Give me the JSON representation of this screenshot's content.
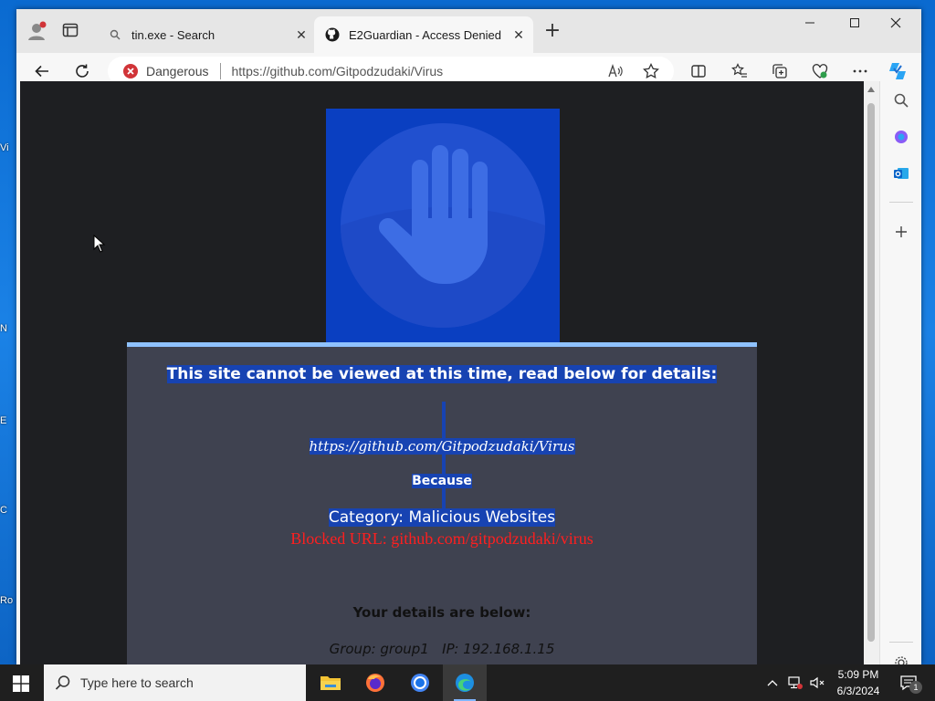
{
  "desktop": {
    "edge_icon_labels": [
      "Vi",
      "N",
      "E",
      "C",
      "Ro"
    ]
  },
  "browser": {
    "tabs": [
      {
        "title": "tin.exe - Search",
        "icon": "search-icon",
        "active": false
      },
      {
        "title": "E2Guardian - Access Denied",
        "icon": "github-icon",
        "active": true
      }
    ],
    "address": {
      "security_label": "Dangerous",
      "url": "https://github.com/Gitpodzudaki/Virus"
    }
  },
  "page": {
    "title": "This site cannot be viewed at this time, read below for details:",
    "url": "https://github.com/Gitpodzudaki/Virus",
    "because": "Because",
    "category": "Category: Malicious Websites",
    "blocked": "Blocked URL: github.com/gitpodzudaki/virus",
    "details_heading": "Your details are below:",
    "group_ip": "Group: group1   IP: 192.168.1.15"
  },
  "taskbar": {
    "search_placeholder": "Type here to search",
    "time": "5:09 PM",
    "date": "6/3/2024",
    "notification_count": "1"
  },
  "colors": {
    "danger": "#d13438",
    "panel": "#3f4250",
    "highlight": "#1743b2",
    "blocked_text": "#ff1f1f"
  }
}
